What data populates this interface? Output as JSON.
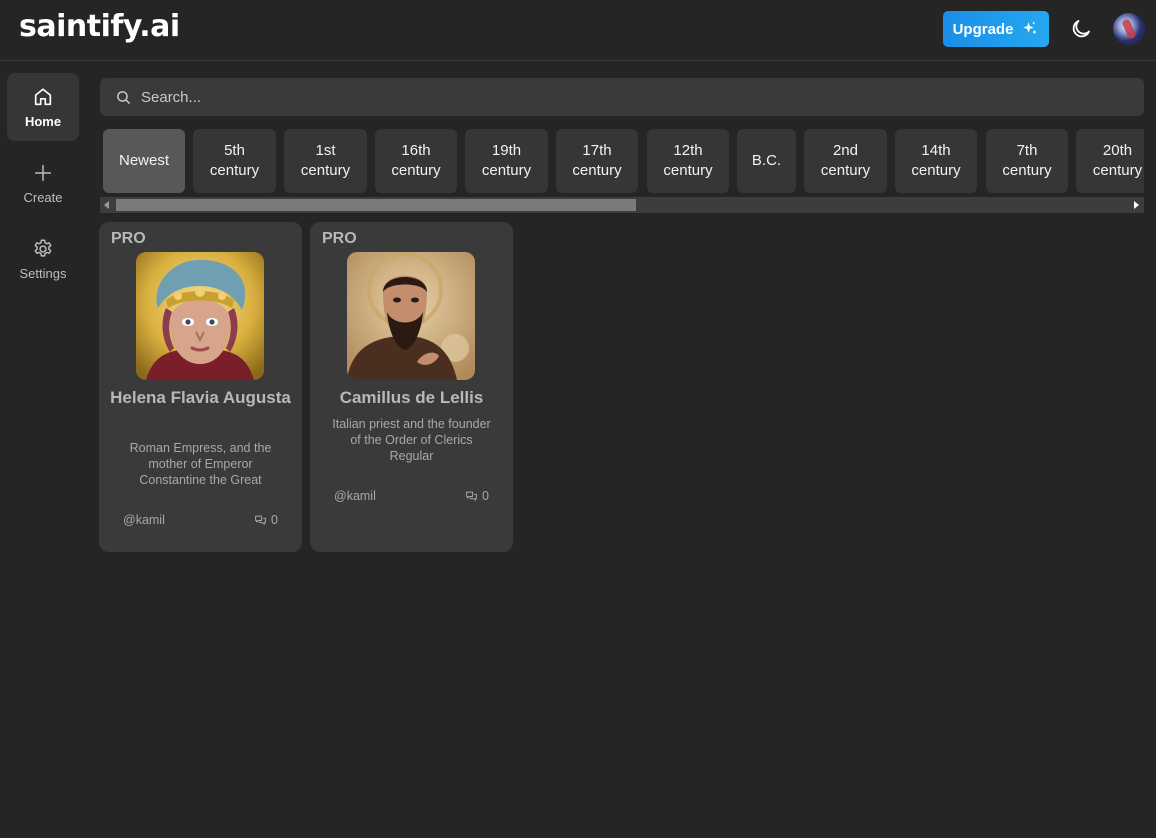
{
  "app": {
    "logo": "saintify.ai",
    "upgrade_label": "Upgrade"
  },
  "sidebar": {
    "items": [
      {
        "label": "Home",
        "icon": "home-icon",
        "active": true
      },
      {
        "label": "Create",
        "icon": "plus-icon",
        "active": false
      },
      {
        "label": "Settings",
        "icon": "gear-icon",
        "active": false
      }
    ]
  },
  "search": {
    "placeholder": "Search...",
    "value": ""
  },
  "filters": {
    "selected": "Newest",
    "chips": [
      {
        "line1": "Newest",
        "line2": ""
      },
      {
        "line1": "5th",
        "line2": "century"
      },
      {
        "line1": "1st",
        "line2": "century"
      },
      {
        "line1": "16th",
        "line2": "century"
      },
      {
        "line1": "19th",
        "line2": "century"
      },
      {
        "line1": "17th",
        "line2": "century"
      },
      {
        "line1": "12th",
        "line2": "century"
      },
      {
        "line1": "B.C.",
        "line2": ""
      },
      {
        "line1": "2nd",
        "line2": "century"
      },
      {
        "line1": "14th",
        "line2": "century"
      },
      {
        "line1": "7th",
        "line2": "century"
      },
      {
        "line1": "20th",
        "line2": "century"
      }
    ]
  },
  "cards": [
    {
      "badge": "PRO",
      "name": "Helena Flavia Augusta",
      "description": "Roman Empress, and the mother of Emperor Constantine the Great",
      "author": "@kamil",
      "chat_count": "0"
    },
    {
      "badge": "PRO",
      "name": "Camillus de Lellis",
      "description": "Italian priest and the founder of the Order of Clerics Regular",
      "author": "@kamil",
      "chat_count": "0"
    }
  ],
  "colors": {
    "background": "#252525",
    "surface": "#3a3a3a",
    "chip": "#363636",
    "chip_active": "#585858",
    "accent": "#1a8ee8"
  }
}
